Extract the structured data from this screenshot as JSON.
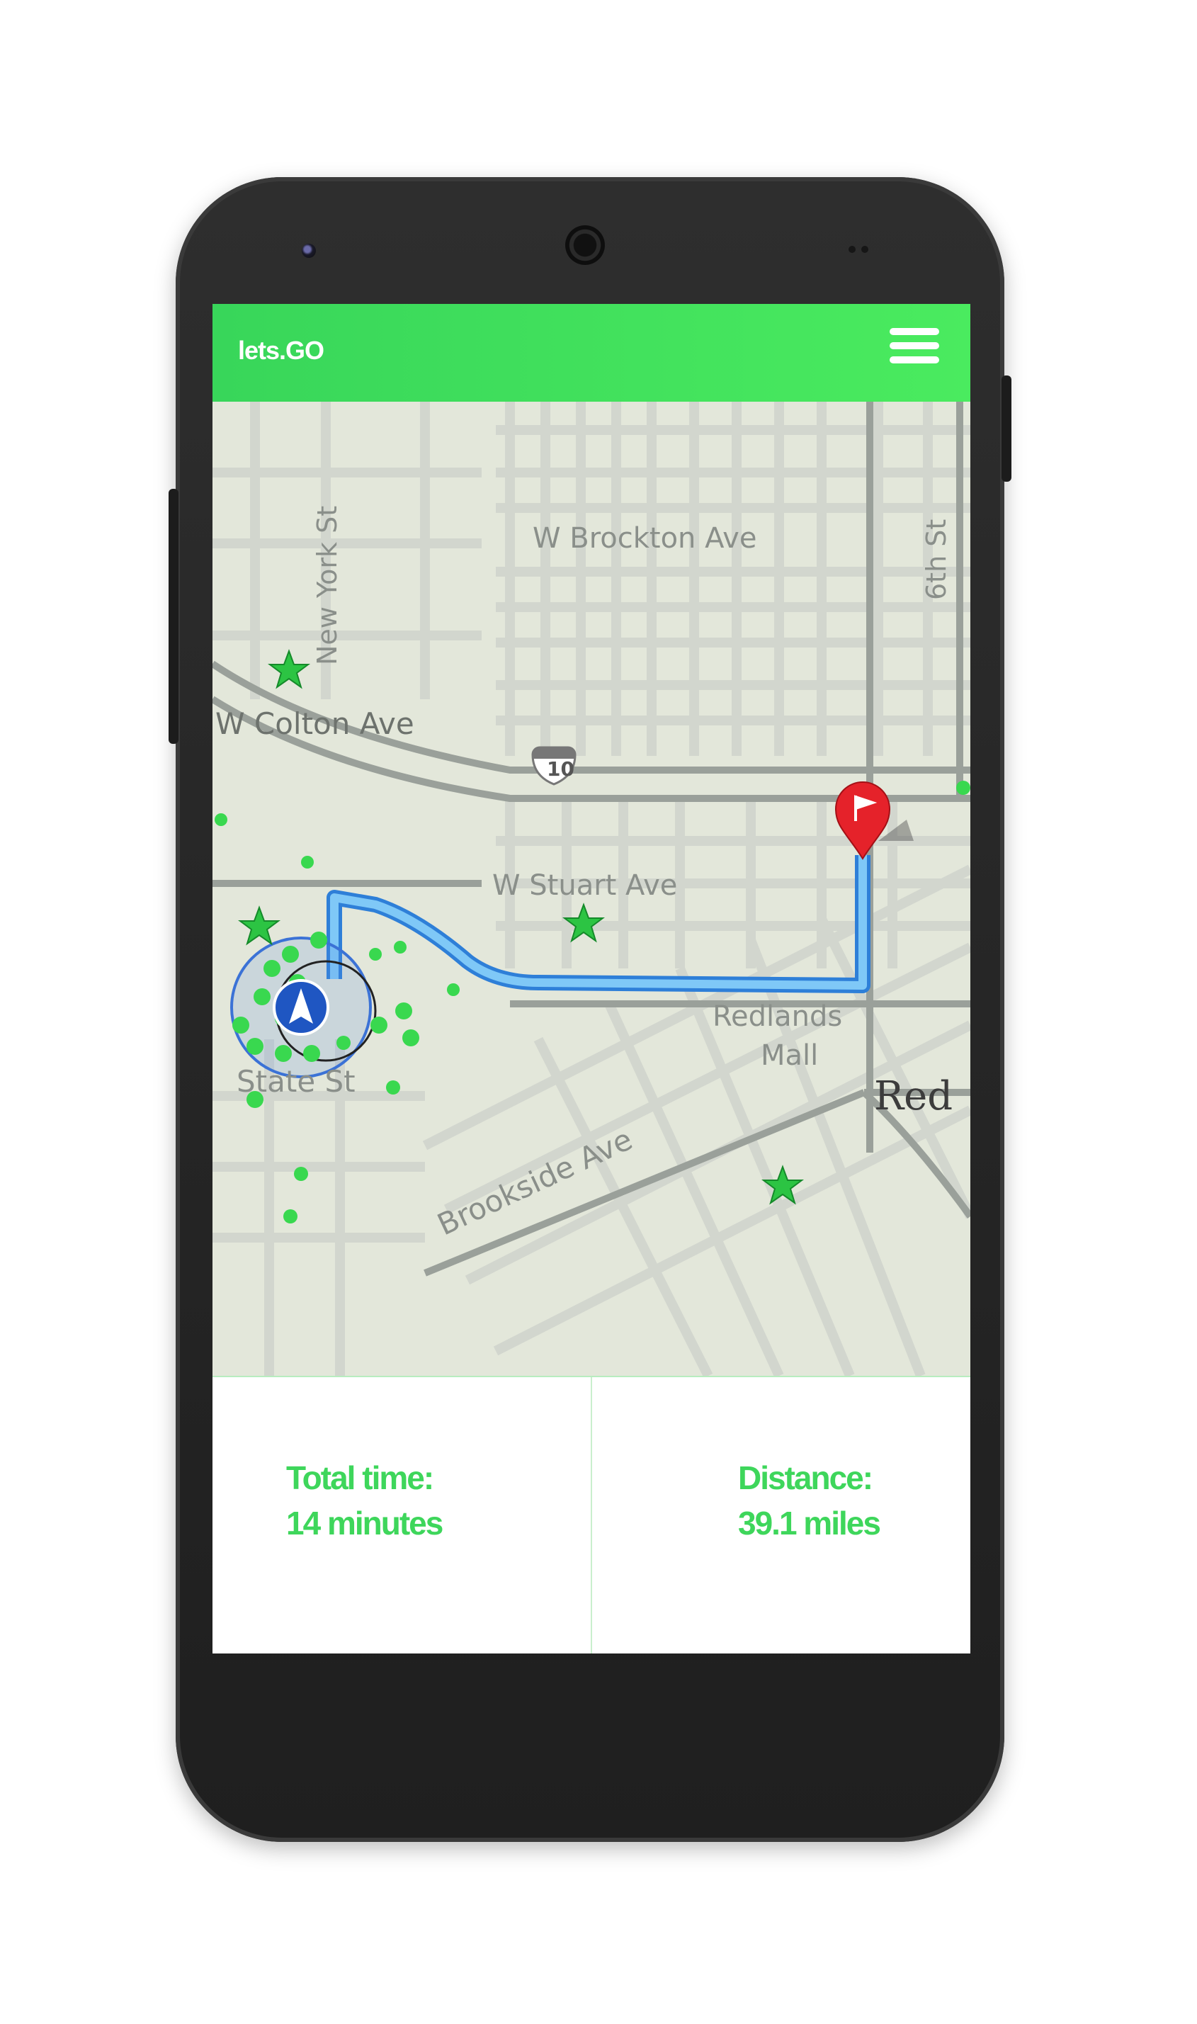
{
  "app": {
    "title": "lets.GO"
  },
  "map": {
    "streets": {
      "brockton": "W Brockton Ave",
      "newyork": "New York St",
      "sixth": "6th St",
      "colton": "W Colton Ave",
      "stuart": "W Stuart Ave",
      "mall": "Redlands",
      "mall2": "Mall",
      "state": "State St",
      "brookside": "Brookside Ave",
      "red": "Red"
    },
    "highway_shield": "10",
    "markers": {
      "start": "navigation-arrow",
      "destination": "flag-pin"
    },
    "colors": {
      "route": "#4aa6ef",
      "poi": "#39d84f",
      "pin": "#e5222a"
    }
  },
  "trip": {
    "time_label": "Total time:",
    "time_value": "14 minutes",
    "distance_label": "Distance:",
    "distance_value": "39.1 miles"
  }
}
